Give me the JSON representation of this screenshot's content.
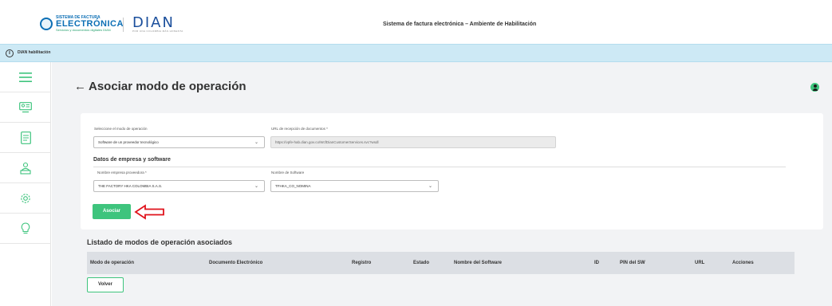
{
  "header": {
    "logo_fe": {
      "line1": "SISTEMA DE FACTURA",
      "line2": "ELECTRÓNICA",
      "line3": "Servicios y documentos digitales DIAN"
    },
    "logo_dian": {
      "name": "DIAN",
      "slogan": "POR UNA COLOMBIA MÁS HONESTA"
    },
    "app_title": "Sistema de factura electrónica – Ambiente de Habilitación"
  },
  "infobar": {
    "text": "DIAN habilitación",
    "icon": "info-icon"
  },
  "sidebar": {
    "items": [
      {
        "icon": "menu-icon"
      },
      {
        "icon": "contact-card-icon"
      },
      {
        "icon": "document-icon"
      },
      {
        "icon": "users-icon"
      },
      {
        "icon": "settings-icon"
      },
      {
        "icon": "lightbulb-icon"
      }
    ]
  },
  "page": {
    "title": "Asociar modo de operación",
    "back_icon": "arrow-left-icon"
  },
  "form": {
    "modo_label": "Seleccione el modo de operación",
    "modo_value": "Software de un proveedor tecnológico",
    "url_label": "URL de recepción de documentos *",
    "url_value": "https://vpfe-hab.dian.gov.co/WcfDianCustomerServices.svc?wsdl",
    "section_title": "Datos de empresa y software",
    "empresa_label": "Nombre empresa proveedora *",
    "empresa_value": "THE FACTORY HKA COLOMBIA S.A.S.",
    "software_label": "Nombre de Software",
    "software_value": "TFHKA_CO_NOMINA",
    "submit_label": "Asociar"
  },
  "list": {
    "title": "Listado de modos de operación asociados",
    "columns": [
      "Modo de operación",
      "Documento Electrónico",
      "Registro",
      "Estado",
      "Nombre del Software",
      "ID",
      "PIN del SW",
      "URL",
      "Acciones"
    ],
    "back_label": "Volver"
  },
  "colors": {
    "accent_green": "#3ec47d",
    "info_bar": "#cde9f5",
    "annotation_red": "#e0121b"
  }
}
